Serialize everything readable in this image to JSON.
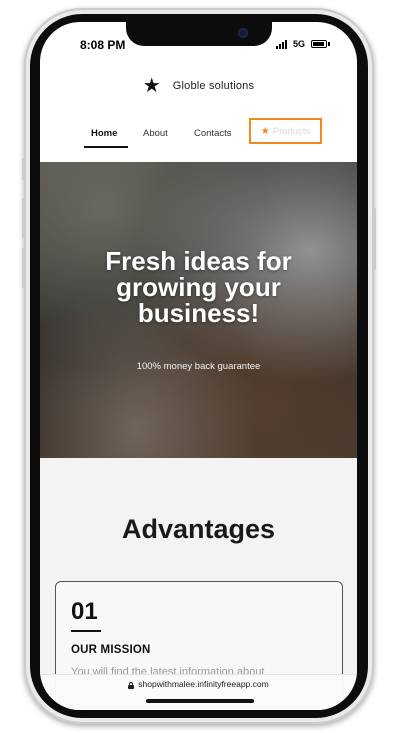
{
  "status_bar": {
    "time": "8:08 PM",
    "network": "5G"
  },
  "header": {
    "brand_icon": "star-icon",
    "brand_name": "Globle solutions"
  },
  "nav": {
    "items": [
      {
        "label": "Home",
        "active": true
      },
      {
        "label": "About"
      },
      {
        "label": "Contacts"
      },
      {
        "label": "Products",
        "icon": "star-icon",
        "highlight_color": "#f08a1d"
      }
    ]
  },
  "hero": {
    "title_lines": [
      "Fresh ideas for",
      "growing your",
      "business!"
    ],
    "subtitle": "100% money back guarantee"
  },
  "advantages": {
    "title": "Advantages",
    "cards": [
      {
        "number": "01",
        "heading": "OUR MISSION",
        "text": "You will find the latest information about"
      }
    ]
  },
  "browser": {
    "url": "shopwithmalee.infinityfreeapp.com",
    "lock_icon": "lock-icon"
  },
  "colors": {
    "accent": "#f08a1d",
    "text": "#111111",
    "background": "#f3f3f3"
  }
}
